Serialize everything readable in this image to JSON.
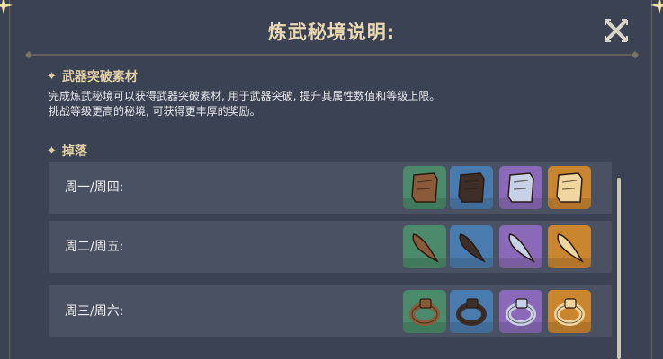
{
  "window": {
    "title": "炼武秘境说明:",
    "close_icon": "close-x-icon"
  },
  "section_materials": {
    "heading": "武器突破素材",
    "desc_line1": "完成炼武秘境可以获得武器突破素材, 用于武器突破, 提升其属性数值和等级上限。",
    "desc_line2": "挑战等级更高的秘境, 可获得更丰厚的奖励。"
  },
  "section_drops": {
    "heading": "掉落",
    "rows": [
      {
        "label": "周一/周四:",
        "items": [
          {
            "rarity": "green",
            "icon": "tile-fragment-icon"
          },
          {
            "rarity": "blue",
            "icon": "tile-fragment-icon"
          },
          {
            "rarity": "purple",
            "icon": "tile-fragment-icon"
          },
          {
            "rarity": "gold",
            "icon": "tile-fragment-icon"
          }
        ]
      },
      {
        "label": "周二/周五:",
        "items": [
          {
            "rarity": "green",
            "icon": "fang-icon"
          },
          {
            "rarity": "blue",
            "icon": "fang-icon"
          },
          {
            "rarity": "purple",
            "icon": "fang-icon"
          },
          {
            "rarity": "gold",
            "icon": "fang-icon"
          }
        ]
      },
      {
        "label": "周三/周六:",
        "items": [
          {
            "rarity": "green",
            "icon": "ring-icon"
          },
          {
            "rarity": "blue",
            "icon": "ring-icon"
          },
          {
            "rarity": "purple",
            "icon": "ring-icon"
          },
          {
            "rarity": "gold",
            "icon": "ring-icon"
          }
        ]
      }
    ]
  },
  "colors": {
    "background": "#3b4254",
    "title": "#e9d8b1",
    "row_background": "#4a5163",
    "rarity_green": "#4b8a6a",
    "rarity_blue": "#4a7bae",
    "rarity_purple": "#8a6ab8",
    "rarity_gold": "#c9862e"
  }
}
